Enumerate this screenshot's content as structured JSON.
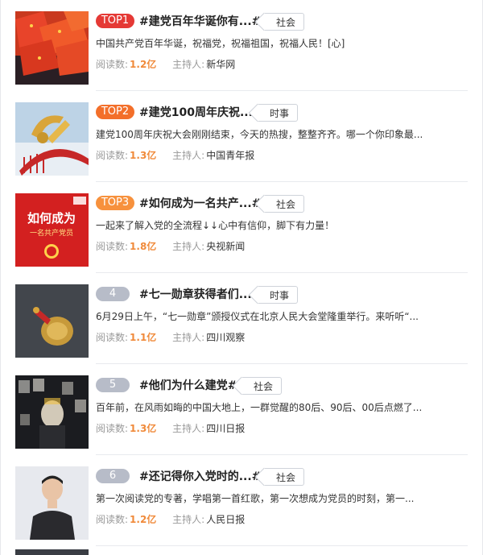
{
  "labels": {
    "read_count": "阅读数:",
    "host": "主持人:"
  },
  "colors": {
    "top1": "#e53935",
    "top2": "#f36f2a",
    "top3": "#f7913d",
    "rank_gray": "#b7bcc8",
    "read_count": "#f08a3a"
  },
  "items": [
    {
      "rank": "TOP1",
      "title": "#建党百年华诞你有...#",
      "tag": "社会",
      "desc": "中国共产党百年华诞，祝福党，祝福祖国，祝福人民！[心]",
      "reads": "1.2亿",
      "host": "新华网",
      "thumb": "red-flags-photo"
    },
    {
      "rank": "TOP2",
      "title": "#建党100周年庆祝...#",
      "tag": "时事",
      "desc": "建党100周年庆祝大会刚刚结束，今天的热搜，整整齐齐。哪一个你印象最...",
      "reads": "1.3亿",
      "host": "中国青年报",
      "thumb": "party-emblem-sculpture-photo"
    },
    {
      "rank": "TOP3",
      "title": "#如何成为一名共产...#",
      "tag": "社会",
      "desc": "一起来了解入党的全流程↓↓心中有信仰，脚下有力量！",
      "reads": "1.8亿",
      "host": "央视新闻",
      "thumb": "red-poster-image",
      "thumb_text": [
        "如何成为",
        "一名共产党员"
      ]
    },
    {
      "rank": "4",
      "title": "#七一勋章获得者们...#",
      "tag": "时事",
      "desc": "6月29日上午，“七一勋章”颁授仪式在北京人民大会堂隆重举行。来听听“...",
      "reads": "1.1亿",
      "host": "四川观察",
      "thumb": "medal-photo"
    },
    {
      "rank": "5",
      "title": "#他们为什么建党#",
      "tag": "社会",
      "desc": "百年前，在风雨如晦的中国大地上，一群觉醒的80后、90后、00后点燃了...",
      "reads": "1.3亿",
      "host": "四川日报",
      "thumb": "historical-portraits-photo"
    },
    {
      "rank": "6",
      "title": "#还记得你入党时的...#",
      "tag": "社会",
      "desc": "第一次阅读党的专著，学唱第一首红歌，第一次想成为党员的时刻，第一...",
      "reads": "1.2亿",
      "host": "人民日报",
      "thumb": "young-man-portrait-photo"
    }
  ]
}
